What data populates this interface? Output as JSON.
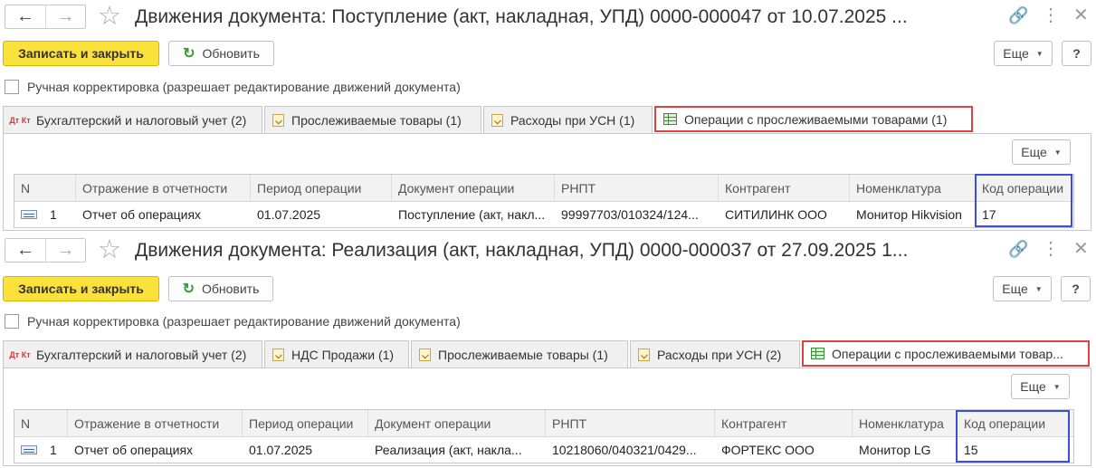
{
  "panels": [
    {
      "title": "Движения документа: Поступление (акт, накладная, УПД) 0000-000047 от 10.07.2025 ...",
      "save_close_label": "Записать и закрыть",
      "refresh_label": "Обновить",
      "more_label": "Еще",
      "help_label": "?",
      "manual_correction_label": "Ручная корректировка (разрешает редактирование движений документа)",
      "tabs": [
        {
          "label": "Бухгалтерский и налоговый учет (2)",
          "icon": "dt-kt-icon"
        },
        {
          "label": "Прослеживаемые товары (1)",
          "icon": "register-doc-icon"
        },
        {
          "label": "Расходы при УСН (1)",
          "icon": "register-doc-icon"
        },
        {
          "label": "Операции с прослеживаемыми товарами (1)",
          "icon": "grid-table-icon",
          "active": true
        }
      ],
      "table_more_label": "Еще",
      "columns": [
        "N",
        "Отражение в отчетности",
        "Период операции",
        "Документ операции",
        "РНПТ",
        "Контрагент",
        "Номенклатура",
        "Код операции"
      ],
      "rows": [
        {
          "n": "1",
          "reporting": "Отчет об операциях",
          "period": "01.07.2025",
          "document": "Поступление (акт, накл...",
          "rnpt": "99997703/010324/124...",
          "counterparty": "СИТИЛИНК ООО",
          "item": "Монитор Hikvision",
          "op_code": "17"
        }
      ]
    },
    {
      "title": "Движения документа: Реализация (акт, накладная, УПД) 0000-000037 от 27.09.2025 1...",
      "save_close_label": "Записать и закрыть",
      "refresh_label": "Обновить",
      "more_label": "Еще",
      "help_label": "?",
      "manual_correction_label": "Ручная корректировка (разрешает редактирование движений документа)",
      "tabs": [
        {
          "label": "Бухгалтерский и налоговый учет (2)",
          "icon": "dt-kt-icon"
        },
        {
          "label": "НДС Продажи (1)",
          "icon": "register-doc-icon"
        },
        {
          "label": "Прослеживаемые товары (1)",
          "icon": "register-doc-icon"
        },
        {
          "label": "Расходы при УСН (2)",
          "icon": "register-doc-icon"
        },
        {
          "label": "Операции с прослеживаемыми товар...",
          "icon": "grid-table-icon",
          "active": true
        }
      ],
      "table_more_label": "Еще",
      "columns": [
        "N",
        "Отражение в отчетности",
        "Период операции",
        "Документ операции",
        "РНПТ",
        "Контрагент",
        "Номенклатура",
        "Код операции"
      ],
      "rows": [
        {
          "n": "1",
          "reporting": "Отчет об операциях",
          "period": "01.07.2025",
          "document": "Реализация (акт, накла...",
          "rnpt": "10218060/040321/0429...",
          "counterparty": "ФОРТЕКС ООО",
          "item": "Монитор LG",
          "op_code": "15"
        }
      ]
    }
  ],
  "dt_kt_text": {
    "dt": "Дт",
    "kt": "Кт"
  },
  "colors": {
    "primary_button": "#fbe13b",
    "active_tab_border": "#e04040",
    "highlight_column_border": "#3a4fe0"
  }
}
